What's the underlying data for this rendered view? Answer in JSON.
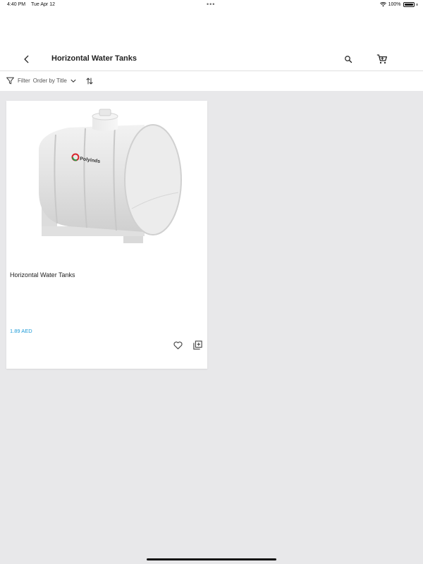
{
  "status_bar": {
    "time": "4:40 PM",
    "date": "Tue Apr 12",
    "battery": "100%"
  },
  "header": {
    "title": "Horizontal Water Tanks",
    "icons": {
      "back": "back-arrow-icon",
      "search": "search-icon",
      "cart": "cart-icon"
    }
  },
  "filter_bar": {
    "filter_label": "Filter",
    "order_label": "Order by Title",
    "icons": {
      "filter": "filter-icon",
      "dropdown": "chevron-down-icon",
      "sort": "sort-icon"
    }
  },
  "products": [
    {
      "name": "Horizontal Water Tanks",
      "price": "1.89 AED",
      "brand": "Polyinds",
      "icons": {
        "wishlist": "heart-icon",
        "compare": "add-to-compare-icon"
      }
    }
  ],
  "colors": {
    "price": "#1e9bd7",
    "background": "#e8e8ea",
    "card": "#ffffff",
    "logo_red": "#d8232a",
    "logo_green": "#2a9a4a"
  }
}
